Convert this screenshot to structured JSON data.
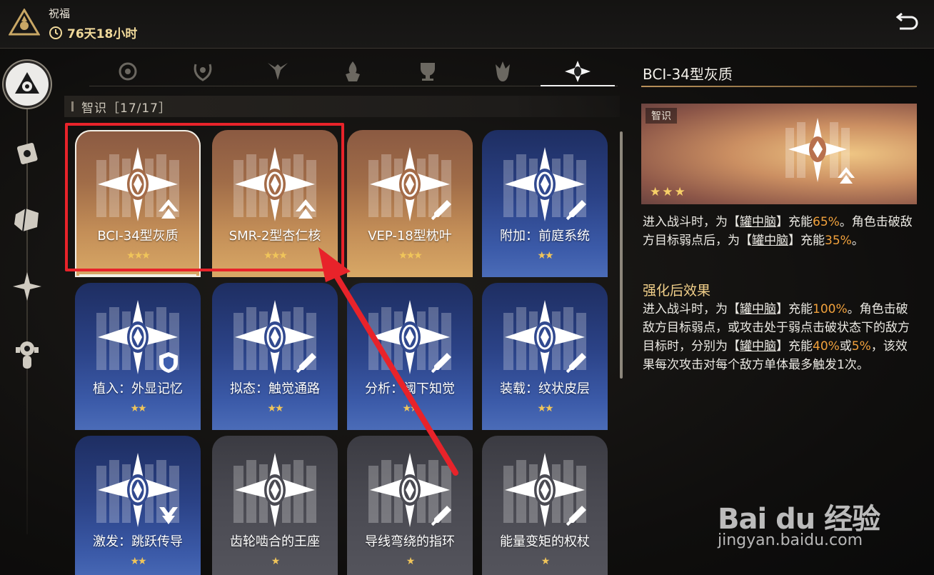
{
  "header": {
    "title": "祝福",
    "timer": "76天18小时"
  },
  "section": {
    "title": "智识［17/17］"
  },
  "cards": [
    {
      "label": "BCI-34型灰质",
      "stars": "★★★",
      "rarity": "gold",
      "badge": "chevron-up-icon"
    },
    {
      "label": "SMR-2型杏仁核",
      "stars": "★★★",
      "rarity": "gold",
      "badge": "chevron-up-icon"
    },
    {
      "label": "VEP-18型枕叶",
      "stars": "★★★",
      "rarity": "gold",
      "badge": "sword-icon"
    },
    {
      "label": "附加：前庭系统",
      "stars": "★★",
      "rarity": "blue",
      "badge": "sword-icon"
    },
    {
      "label": "植入：外显记忆",
      "stars": "★★",
      "rarity": "blue",
      "badge": "shield-icon"
    },
    {
      "label": "拟态：触觉通路",
      "stars": "★★",
      "rarity": "blue",
      "badge": "sword-icon"
    },
    {
      "label": "分析：阈下知觉",
      "stars": "★★",
      "rarity": "blue",
      "badge": "sword-icon"
    },
    {
      "label": "装载：纹状皮层",
      "stars": "★★",
      "rarity": "blue",
      "badge": "sword-icon"
    },
    {
      "label": "激发：跳跃传导",
      "stars": "★★",
      "rarity": "blue",
      "badge": "chevron-down-icon"
    },
    {
      "label": "齿轮啮合的王座",
      "stars": "★",
      "rarity": "gray",
      "badge": ""
    },
    {
      "label": "导线弯绕的指环",
      "stars": "★",
      "rarity": "gray",
      "badge": "sword-icon"
    },
    {
      "label": "能量变矩的权杖",
      "stars": "★",
      "rarity": "gray",
      "badge": "sword-icon"
    }
  ],
  "detail": {
    "title": "BCI-34型灰质",
    "tag": "智识",
    "stars": "★★★",
    "desc": {
      "p1": "进入战斗时，为【",
      "k1": "罐中脑",
      "p2": "】充能",
      "v1": "65%",
      "p3": "。角色击破敌方目标弱点后，为【",
      "k2": "罐中脑",
      "p4": "】充能",
      "v2": "35%",
      "p5": "。"
    },
    "enhanced_title": "强化后效果",
    "enhanced": {
      "p1": "进入战斗时，为【",
      "k1": "罐中脑",
      "p2": "】充能",
      "v1": "100%",
      "p3": "。角色击破敌方目标弱点，或攻击处于弱点击破状态下的敌方目标时，分别为【",
      "k2": "罐中脑",
      "p4": "】充能",
      "v2": "40%",
      "p5": "或",
      "v3": "5%",
      "p6": "，该效果每次攻击对每个敌方单体最多触发1次。"
    }
  },
  "watermark": {
    "logo": "Bai du 经验",
    "url": "jingyan.baidu.com"
  },
  "colors": {
    "accent_gold": "#f0c55a",
    "highlight_red": "#e8232a",
    "value_orange": "#f1a13c"
  }
}
